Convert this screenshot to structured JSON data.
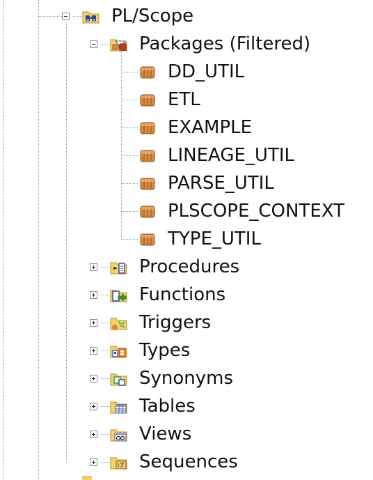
{
  "tree": {
    "root": {
      "label": "PL/Scope",
      "icon": "binoculars-connection-icon",
      "expanded": true
    },
    "packages": {
      "label": "Packages (Filtered)",
      "icon": "filtered-folder-icon",
      "expanded": true,
      "items": [
        {
          "label": "DD_UTIL",
          "icon": "package-icon"
        },
        {
          "label": "ETL",
          "icon": "package-icon"
        },
        {
          "label": "EXAMPLE",
          "icon": "package-icon"
        },
        {
          "label": "LINEAGE_UTIL",
          "icon": "package-icon"
        },
        {
          "label": "PARSE_UTIL",
          "icon": "package-icon"
        },
        {
          "label": "PLSCOPE_CONTEXT",
          "icon": "package-icon"
        },
        {
          "label": "TYPE_UTIL",
          "icon": "package-icon"
        }
      ]
    },
    "folders": [
      {
        "label": "Procedures",
        "icon": "procedures-folder-icon",
        "expanded": false
      },
      {
        "label": "Functions",
        "icon": "functions-folder-icon",
        "expanded": false
      },
      {
        "label": "Triggers",
        "icon": "triggers-folder-icon",
        "expanded": false
      },
      {
        "label": "Types",
        "icon": "types-folder-icon",
        "expanded": false
      },
      {
        "label": "Synonyms",
        "icon": "synonyms-folder-icon",
        "expanded": false
      },
      {
        "label": "Tables",
        "icon": "tables-folder-icon",
        "expanded": false
      },
      {
        "label": "Views",
        "icon": "views-folder-icon",
        "expanded": false
      },
      {
        "label": "Sequences",
        "icon": "sequences-folder-icon",
        "expanded": false
      }
    ]
  },
  "colors": {
    "folder": "#f3d36b",
    "folder_edge": "#b98f22",
    "package": "#d98b3f",
    "guide": "#9a9a9a"
  }
}
